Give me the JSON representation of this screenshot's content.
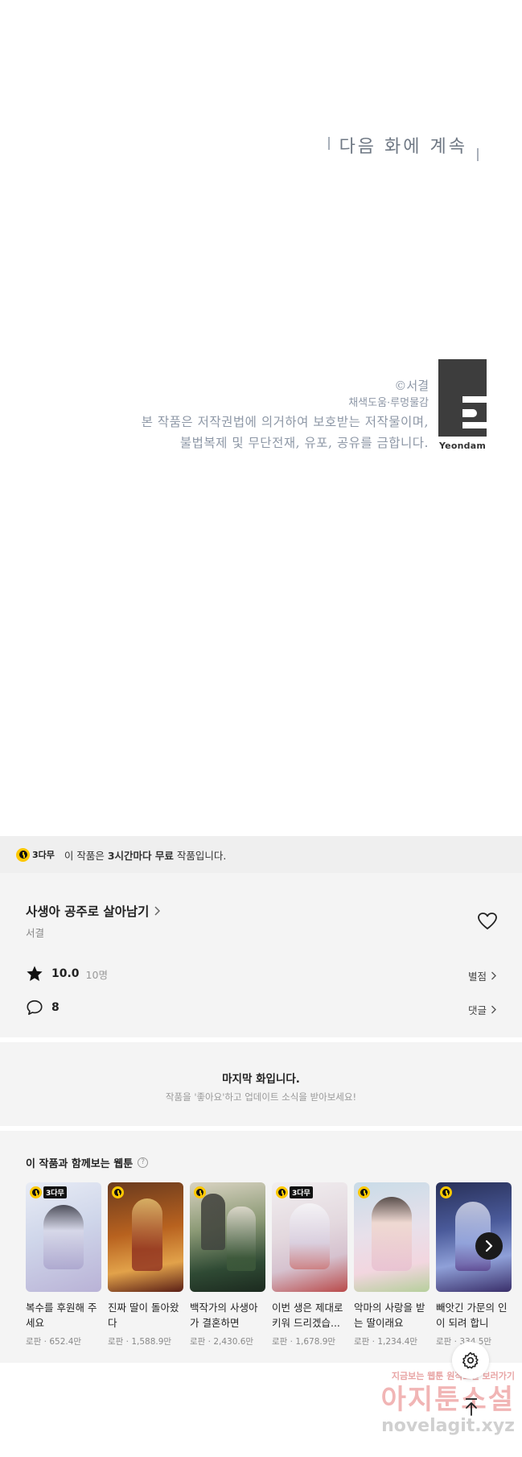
{
  "comic": {
    "to_be_continued": "다음 화에 계속",
    "copyright": "©서결",
    "colorist": "채색도움·루멍물감",
    "notice_line1": "본 작품은 저작권법에 의거하여 보호받는 저작물이며,",
    "notice_line2": "불법복제 및 무단전재, 유포, 공유를 금합니다.",
    "publisher": "Yeondam"
  },
  "free_bar": {
    "badge": "3다무",
    "text_before": "이 작품은 ",
    "text_bold": "3시간마다 무료",
    "text_after": " 작품입니다."
  },
  "work": {
    "title": "사생아 공주로 살아남기",
    "author": "서결",
    "rating": "10.0",
    "rating_count": "10명",
    "rate_link": "별점",
    "comment_count": "8",
    "comment_link": "댓글"
  },
  "last_episode": {
    "title": "마지막 화입니다.",
    "subtitle": "작품을 '좋아요'하고 업데이트 소식을 받아보세요!"
  },
  "recommendations": {
    "title": "이 작품과 함께보는 웹툰",
    "help": "?",
    "items": [
      {
        "name": "복수를 후원해 주세요",
        "meta": "로판 · 652.4만",
        "badge": "3다무"
      },
      {
        "name": "진짜 딸이 돌아왔다",
        "meta": "로판 · 1,588.9만",
        "badge": ""
      },
      {
        "name": "백작가의 사생아가 결혼하면",
        "meta": "로판 · 2,430.6만",
        "badge": ""
      },
      {
        "name": "이번 생은 제대로 키워 드리겠습...",
        "meta": "로판 · 1,678.9만",
        "badge": "3다무"
      },
      {
        "name": "악마의 사랑을 받는 딸이래요",
        "meta": "로판 · 1,234.4만",
        "badge": ""
      },
      {
        "name": "빼앗긴 가문의 인이 되려 합니",
        "meta": "로판 · 334.5만",
        "badge": ""
      }
    ]
  },
  "watermark": {
    "top": "지금보는 웹툰 원작소설 보러가기",
    "main": "아지툰소설",
    "url": "novelagit.xyz"
  },
  "colors": {
    "accent_yellow": "#ffc800",
    "panel_bg": "#f4f4f4",
    "bar_bg": "#efefef"
  }
}
